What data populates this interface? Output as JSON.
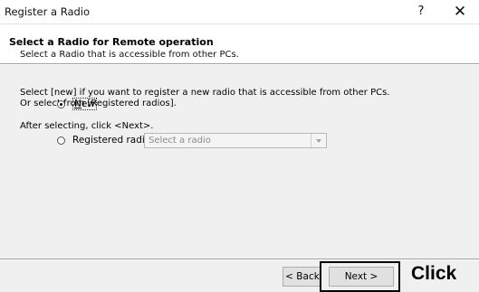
{
  "window": {
    "title": "Register a Radio",
    "help_glyph": "?",
    "close_glyph": "✕"
  },
  "header": {
    "title": "Select a Radio for Remote operation",
    "subtitle": "Select a Radio that is accessible from other PCs."
  },
  "content": {
    "instruction_line1": "Select [new] if you want to register a new radio that is accessible from other PCs.",
    "instruction_line2": "Or select from [Registered radios].",
    "instruction_line3": "After selecting, click <Next>."
  },
  "options": {
    "new_label": "New",
    "new_selected": true,
    "registered_label": "Registered radios",
    "registered_selected": false,
    "combo_placeholder": "Select a radio"
  },
  "buttons": {
    "back_label": "< Back",
    "next_label": "Next >"
  },
  "annotation": {
    "click_label": "Click"
  }
}
